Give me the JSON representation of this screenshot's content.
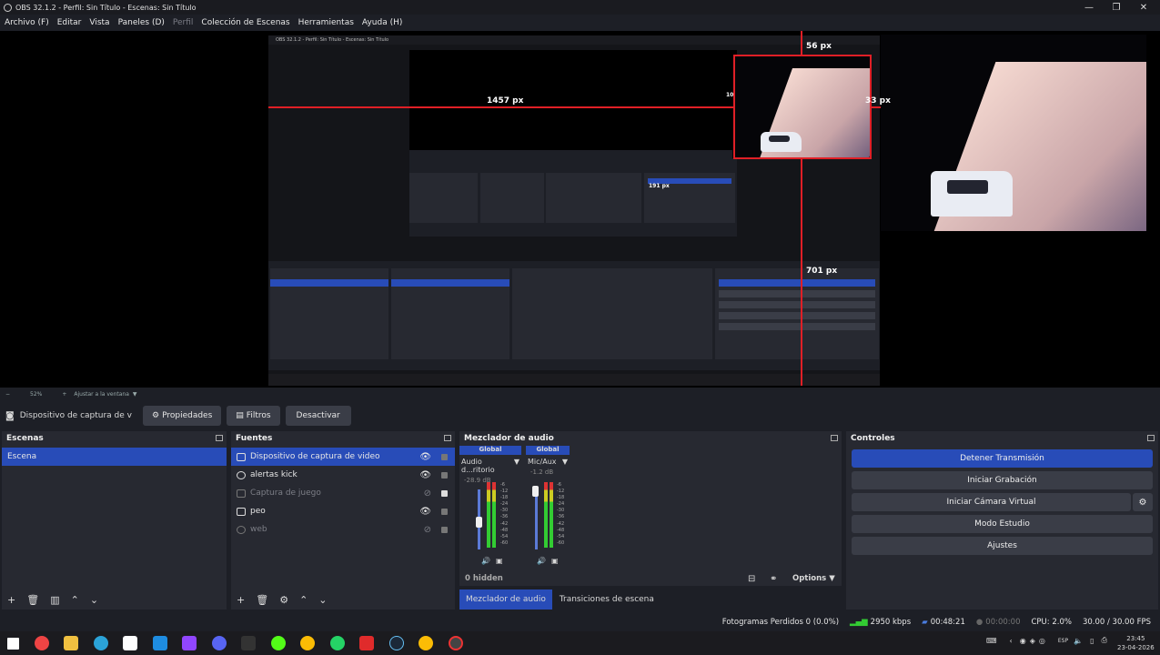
{
  "window": {
    "title": "OBS 32.1.2 - Perfil: Sin Título - Escenas: Sin Título",
    "minimize": "—",
    "maximize": "❐",
    "close": "✕"
  },
  "menu": {
    "items": [
      "Archivo (F)",
      "Editar",
      "Vista",
      "Paneles (D)",
      "Perfil",
      "Colección de Escenas",
      "Herramientas",
      "Ayuda (H)"
    ]
  },
  "preview": {
    "measure_top": "56 px",
    "measure_left": "1457 px",
    "measure_right": "33 px",
    "measure_bottom": "701 px",
    "inner_title": "OBS 32.1.2 - Perfil: Sin Título - Escenas: Sin Título",
    "inner_measure_a": "191 px",
    "inner_measure_b": "109 px"
  },
  "zoom": {
    "minus": "−",
    "value": "52%",
    "plus": "+",
    "fit": "Ajustar a la ventana"
  },
  "sourcebar": {
    "source_name": "Dispositivo de captura de v",
    "properties": "Propiedades",
    "filters": "Filtros",
    "deactivate": "Desactivar"
  },
  "scenes": {
    "title": "Escenas",
    "items": [
      "Escena"
    ]
  },
  "sources": {
    "title": "Fuentes",
    "items": [
      "Dispositivo de captura de video",
      "alertas kick",
      "Captura de juego",
      "peo",
      "web"
    ]
  },
  "mixer": {
    "title": "Mezclador de audio",
    "channels": [
      {
        "scope": "Global",
        "name": "Audio d...ritorio",
        "db": "-28.9 dB"
      },
      {
        "scope": "Global",
        "name": "Mic/Aux",
        "db": "-1.2 dB"
      }
    ],
    "ticks": [
      "-6",
      "-12",
      "-18",
      "-24",
      "-30",
      "-36",
      "-42",
      "-48",
      "-54",
      "-60"
    ],
    "hidden": "0 hidden",
    "options": "Options",
    "tab_mixer": "Mezclador de audio",
    "tab_transitions": "Transiciones de escena",
    "levels": {
      "desktop_fader": 0.45,
      "mic_fader": 0.9
    }
  },
  "controls": {
    "title": "Controles",
    "stop_stream": "Detener Transmisión",
    "start_record": "Iniciar Grabación",
    "virtual_cam": "Iniciar Cámara Virtual",
    "studio": "Modo Estudio",
    "settings": "Ajustes"
  },
  "status": {
    "dropped": "Fotogramas Perdidos 0 (0.0%)",
    "bitrate": "2950 kbps",
    "stream_time": "00:48:21",
    "record_time": "00:00:00",
    "cpu": "CPU: 2.0%",
    "fps": "30.00 / 30.00 FPS"
  },
  "taskbar": {
    "time": "23:45",
    "date": "23-04-2026",
    "lang": "ESP"
  },
  "colors": {
    "accent": "#284cb8",
    "panel": "#272931",
    "background": "#1d1f26",
    "measure_line": "#e01f26"
  }
}
